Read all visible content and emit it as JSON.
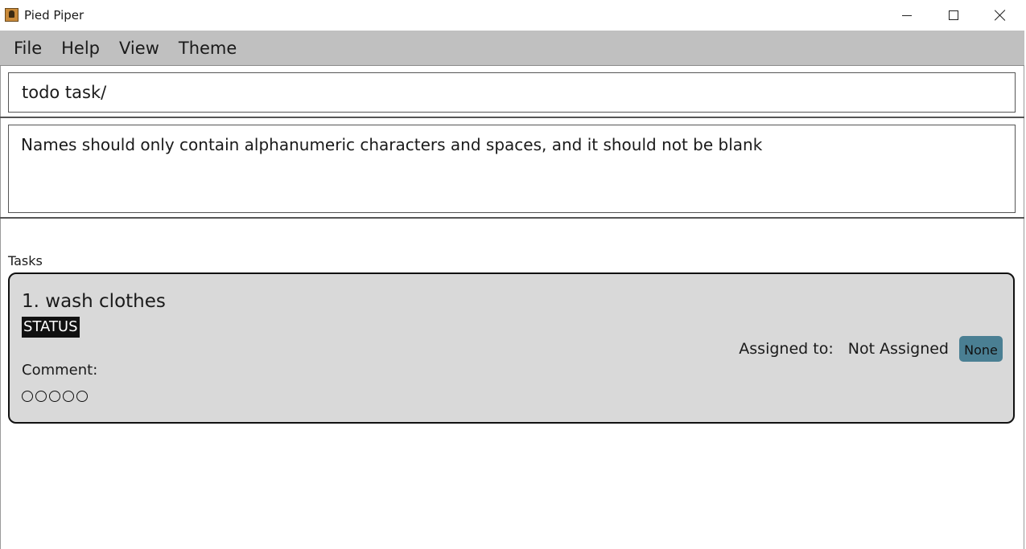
{
  "window": {
    "title": "Pied Piper"
  },
  "menu": {
    "items": [
      "File",
      "Help",
      "View",
      "Theme"
    ]
  },
  "command": {
    "value": "todo task/"
  },
  "result": {
    "message": "Names should only contain alphanumeric characters and spaces, and it should not be blank"
  },
  "tasks": {
    "header": "Tasks",
    "items": [
      {
        "title": "1. wash clothes",
        "status_label": "STATUS",
        "comment_label": "Comment:",
        "rating_filled": 0,
        "rating_max": 5,
        "assigned_label": "Assigned to:",
        "assigned_value": "Not Assigned",
        "assign_button": "None"
      }
    ]
  },
  "colors": {
    "menu_bg": "#c0c0c0",
    "card_bg": "#d9d9d9",
    "assign_button_bg": "#4a7f93",
    "status_bg": "#111111"
  }
}
